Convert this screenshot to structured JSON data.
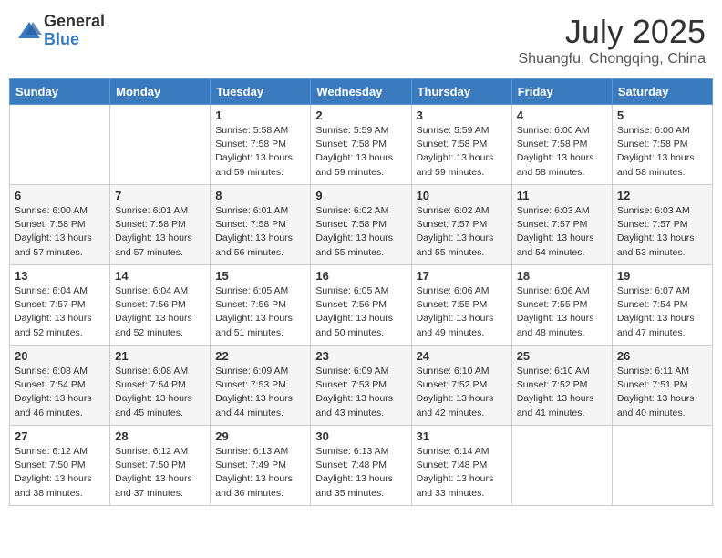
{
  "header": {
    "logo_general": "General",
    "logo_blue": "Blue",
    "month_title": "July 2025",
    "location": "Shuangfu, Chongqing, China"
  },
  "days_of_week": [
    "Sunday",
    "Monday",
    "Tuesday",
    "Wednesday",
    "Thursday",
    "Friday",
    "Saturday"
  ],
  "weeks": [
    [
      {
        "day": "",
        "info": ""
      },
      {
        "day": "",
        "info": ""
      },
      {
        "day": "1",
        "info": "Sunrise: 5:58 AM\nSunset: 7:58 PM\nDaylight: 13 hours and 59 minutes."
      },
      {
        "day": "2",
        "info": "Sunrise: 5:59 AM\nSunset: 7:58 PM\nDaylight: 13 hours and 59 minutes."
      },
      {
        "day": "3",
        "info": "Sunrise: 5:59 AM\nSunset: 7:58 PM\nDaylight: 13 hours and 59 minutes."
      },
      {
        "day": "4",
        "info": "Sunrise: 6:00 AM\nSunset: 7:58 PM\nDaylight: 13 hours and 58 minutes."
      },
      {
        "day": "5",
        "info": "Sunrise: 6:00 AM\nSunset: 7:58 PM\nDaylight: 13 hours and 58 minutes."
      }
    ],
    [
      {
        "day": "6",
        "info": "Sunrise: 6:00 AM\nSunset: 7:58 PM\nDaylight: 13 hours and 57 minutes."
      },
      {
        "day": "7",
        "info": "Sunrise: 6:01 AM\nSunset: 7:58 PM\nDaylight: 13 hours and 57 minutes."
      },
      {
        "day": "8",
        "info": "Sunrise: 6:01 AM\nSunset: 7:58 PM\nDaylight: 13 hours and 56 minutes."
      },
      {
        "day": "9",
        "info": "Sunrise: 6:02 AM\nSunset: 7:58 PM\nDaylight: 13 hours and 55 minutes."
      },
      {
        "day": "10",
        "info": "Sunrise: 6:02 AM\nSunset: 7:57 PM\nDaylight: 13 hours and 55 minutes."
      },
      {
        "day": "11",
        "info": "Sunrise: 6:03 AM\nSunset: 7:57 PM\nDaylight: 13 hours and 54 minutes."
      },
      {
        "day": "12",
        "info": "Sunrise: 6:03 AM\nSunset: 7:57 PM\nDaylight: 13 hours and 53 minutes."
      }
    ],
    [
      {
        "day": "13",
        "info": "Sunrise: 6:04 AM\nSunset: 7:57 PM\nDaylight: 13 hours and 52 minutes."
      },
      {
        "day": "14",
        "info": "Sunrise: 6:04 AM\nSunset: 7:56 PM\nDaylight: 13 hours and 52 minutes."
      },
      {
        "day": "15",
        "info": "Sunrise: 6:05 AM\nSunset: 7:56 PM\nDaylight: 13 hours and 51 minutes."
      },
      {
        "day": "16",
        "info": "Sunrise: 6:05 AM\nSunset: 7:56 PM\nDaylight: 13 hours and 50 minutes."
      },
      {
        "day": "17",
        "info": "Sunrise: 6:06 AM\nSunset: 7:55 PM\nDaylight: 13 hours and 49 minutes."
      },
      {
        "day": "18",
        "info": "Sunrise: 6:06 AM\nSunset: 7:55 PM\nDaylight: 13 hours and 48 minutes."
      },
      {
        "day": "19",
        "info": "Sunrise: 6:07 AM\nSunset: 7:54 PM\nDaylight: 13 hours and 47 minutes."
      }
    ],
    [
      {
        "day": "20",
        "info": "Sunrise: 6:08 AM\nSunset: 7:54 PM\nDaylight: 13 hours and 46 minutes."
      },
      {
        "day": "21",
        "info": "Sunrise: 6:08 AM\nSunset: 7:54 PM\nDaylight: 13 hours and 45 minutes."
      },
      {
        "day": "22",
        "info": "Sunrise: 6:09 AM\nSunset: 7:53 PM\nDaylight: 13 hours and 44 minutes."
      },
      {
        "day": "23",
        "info": "Sunrise: 6:09 AM\nSunset: 7:53 PM\nDaylight: 13 hours and 43 minutes."
      },
      {
        "day": "24",
        "info": "Sunrise: 6:10 AM\nSunset: 7:52 PM\nDaylight: 13 hours and 42 minutes."
      },
      {
        "day": "25",
        "info": "Sunrise: 6:10 AM\nSunset: 7:52 PM\nDaylight: 13 hours and 41 minutes."
      },
      {
        "day": "26",
        "info": "Sunrise: 6:11 AM\nSunset: 7:51 PM\nDaylight: 13 hours and 40 minutes."
      }
    ],
    [
      {
        "day": "27",
        "info": "Sunrise: 6:12 AM\nSunset: 7:50 PM\nDaylight: 13 hours and 38 minutes."
      },
      {
        "day": "28",
        "info": "Sunrise: 6:12 AM\nSunset: 7:50 PM\nDaylight: 13 hours and 37 minutes."
      },
      {
        "day": "29",
        "info": "Sunrise: 6:13 AM\nSunset: 7:49 PM\nDaylight: 13 hours and 36 minutes."
      },
      {
        "day": "30",
        "info": "Sunrise: 6:13 AM\nSunset: 7:48 PM\nDaylight: 13 hours and 35 minutes."
      },
      {
        "day": "31",
        "info": "Sunrise: 6:14 AM\nSunset: 7:48 PM\nDaylight: 13 hours and 33 minutes."
      },
      {
        "day": "",
        "info": ""
      },
      {
        "day": "",
        "info": ""
      }
    ]
  ]
}
